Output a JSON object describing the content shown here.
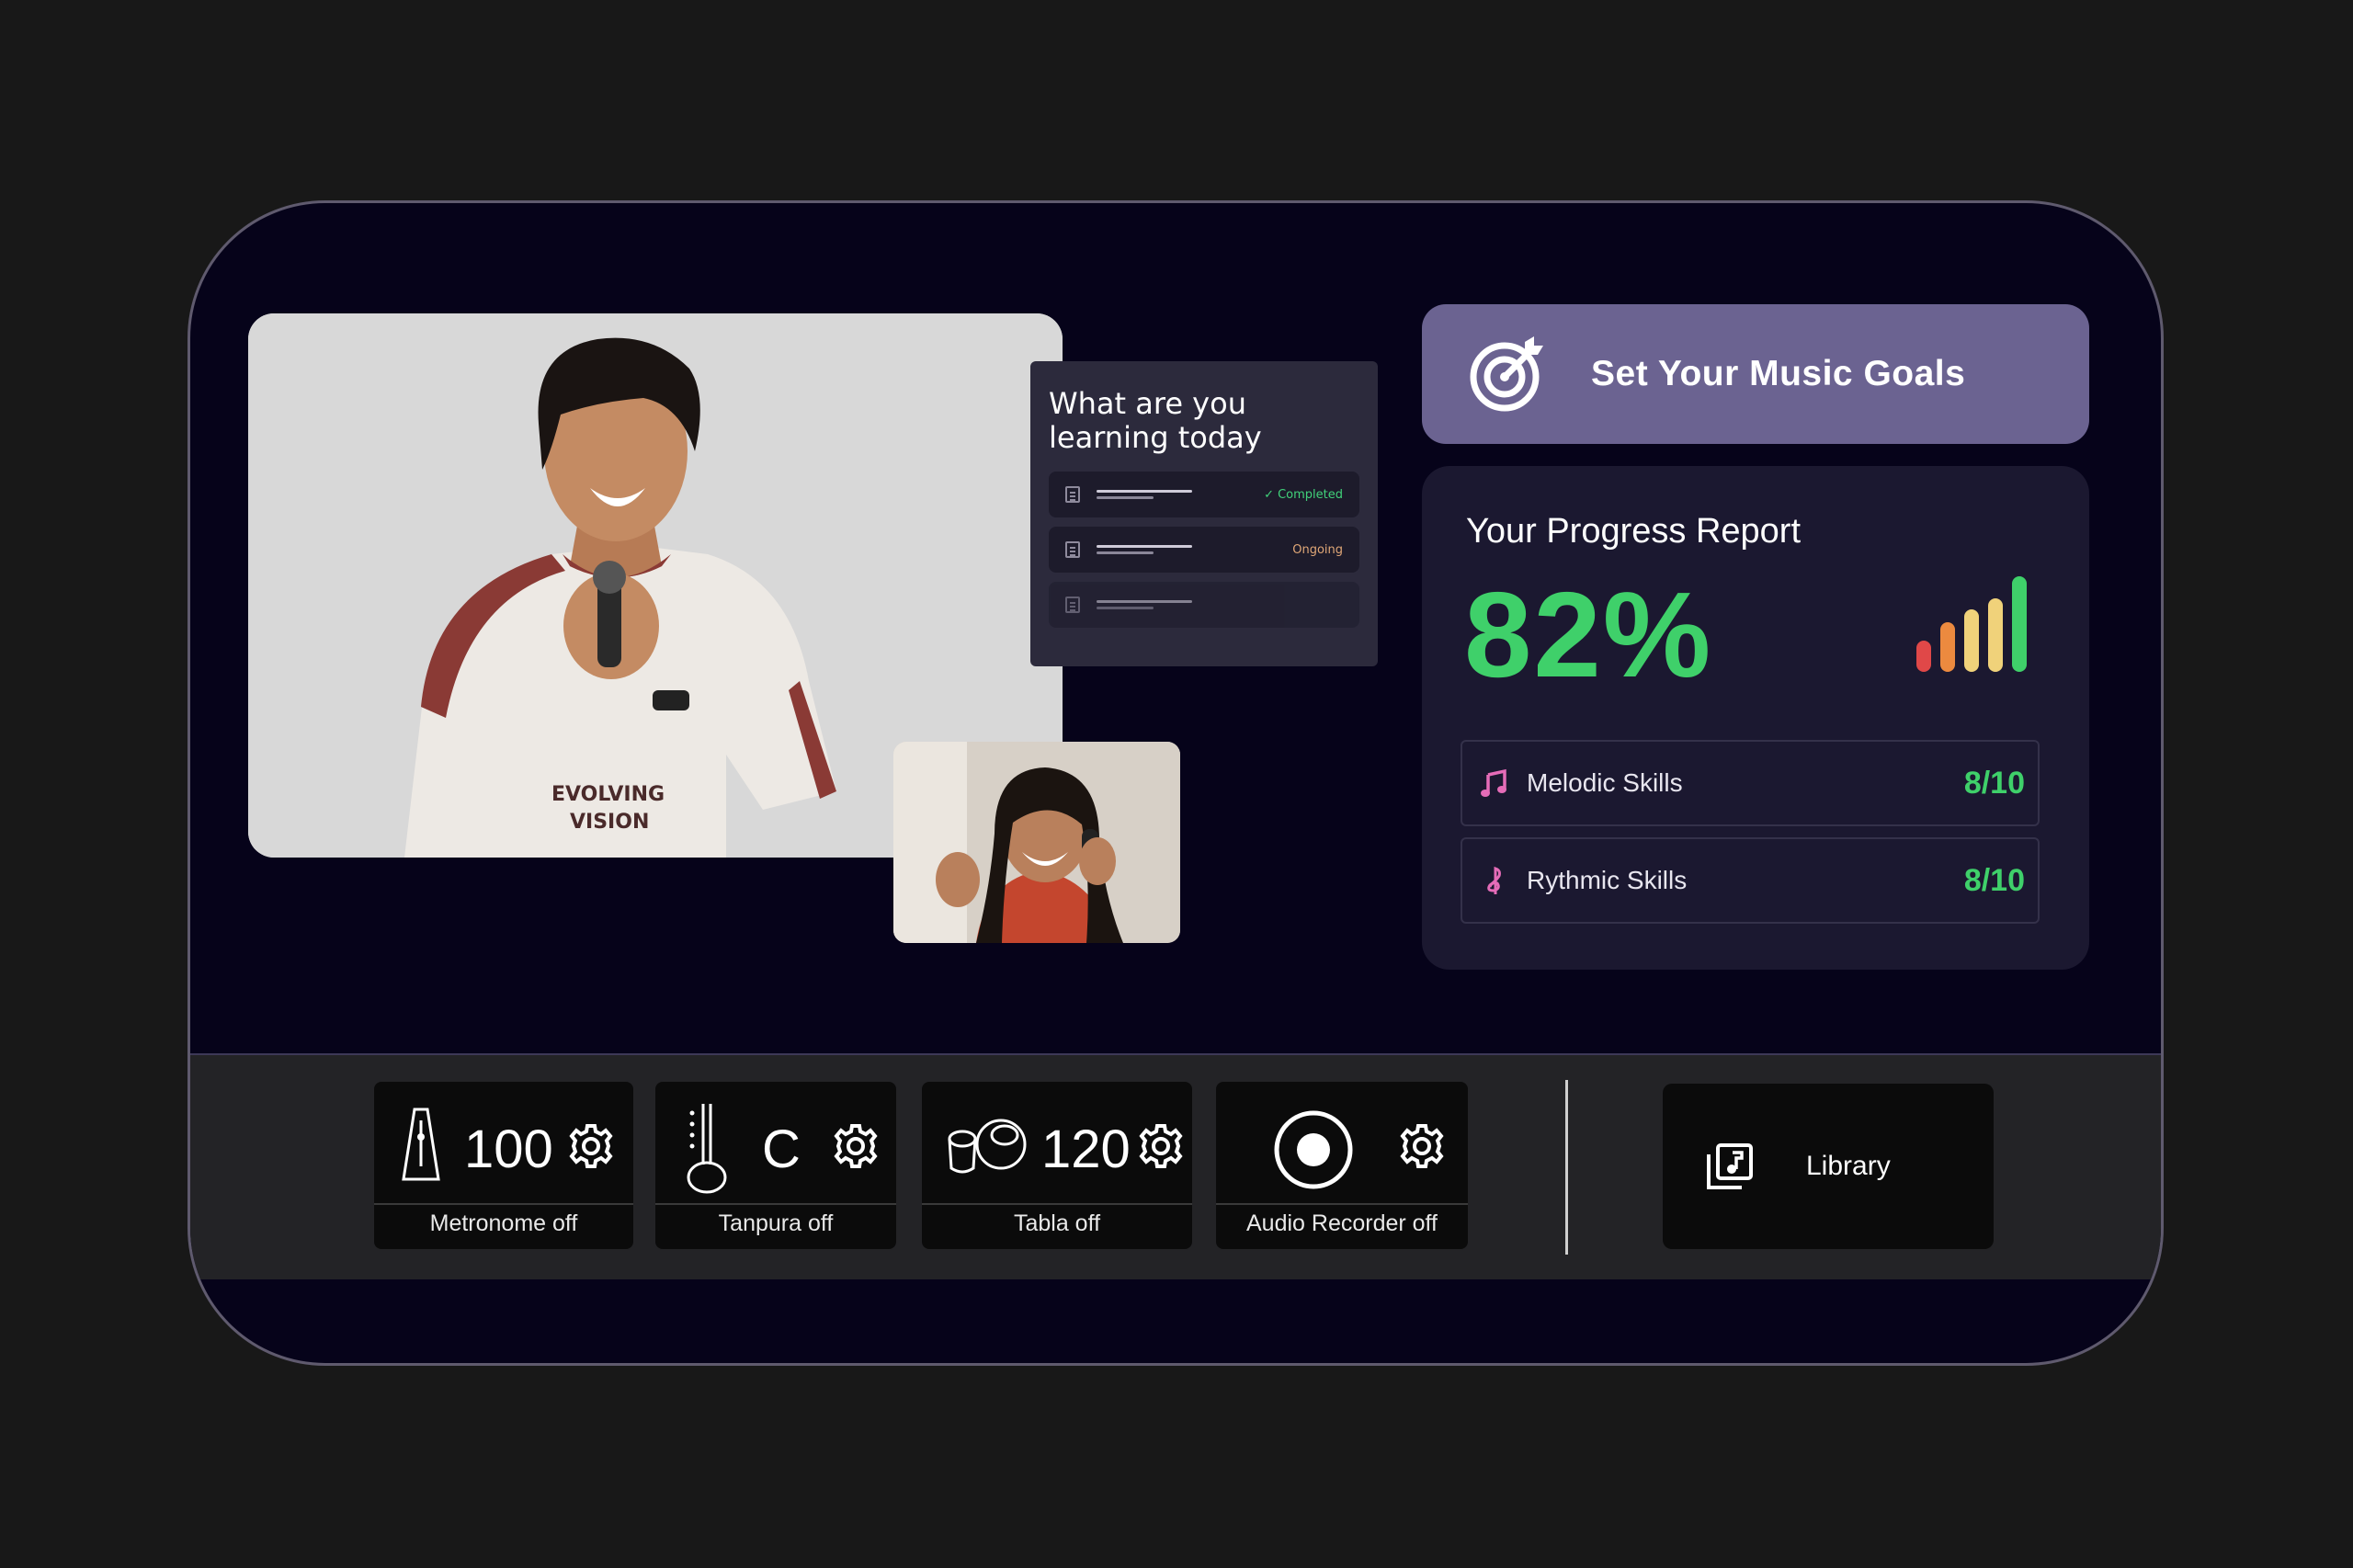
{
  "learning_card": {
    "title": "What are you learning today",
    "items": [
      {
        "status": "Completed",
        "icon": "document-icon"
      },
      {
        "status": "Ongoing",
        "icon": "document-icon"
      },
      {
        "status": "",
        "icon": "document-icon"
      }
    ]
  },
  "goals": {
    "title": "Set Your Music Goals",
    "icon": "target-icon"
  },
  "progress": {
    "title": "Your Progress Report",
    "value": "82%",
    "signal_icon": "signal-bars-icon",
    "skills": [
      {
        "label": "Melodic Skills",
        "score": "8/10",
        "icon": "music-note-icon"
      },
      {
        "label": "Rythmic Skills",
        "score": "8/10",
        "icon": "treble-clef-icon"
      }
    ]
  },
  "toolbar": {
    "metronome": {
      "value": "100",
      "label": "Metronome off",
      "icon": "metronome-icon"
    },
    "tanpura": {
      "value": "C",
      "label": "Tanpura off",
      "icon": "tanpura-icon"
    },
    "tabla": {
      "value": "120",
      "label": "Tabla off",
      "icon": "tabla-icon"
    },
    "recorder": {
      "label": "Audio Recorder off",
      "icon": "record-icon"
    },
    "library": {
      "label": "Library",
      "icon": "music-library-icon"
    }
  },
  "colors": {
    "accent_green": "#3fd06a",
    "goals_bg": "#6b6391",
    "frame_bg": "#06031a",
    "bar_colors": [
      "#e04848",
      "#ec8a3f",
      "#f0d27a",
      "#3fd06a"
    ]
  }
}
